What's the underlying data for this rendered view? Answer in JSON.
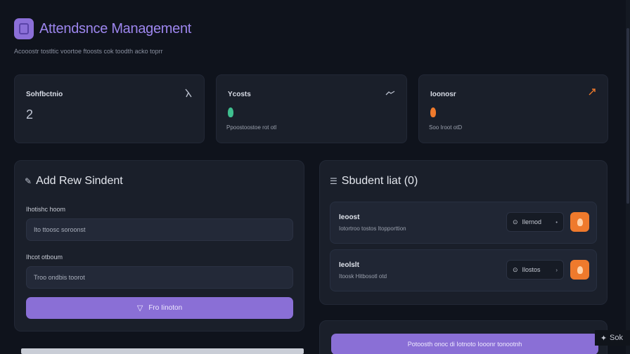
{
  "header": {
    "title": "Attendsnce Management",
    "subtitle": "Acooostr tostltic voortoe ftoosts  cok  toodth acko toprr"
  },
  "stats": [
    {
      "label": "Sohfbctnio",
      "value": "2",
      "icon": "user-icon",
      "color": "#b9bfcc"
    },
    {
      "label": "Ycosts",
      "note": "Ppoostoostoe rot otl",
      "icon": "check-icon",
      "color": "#3fbf8f"
    },
    {
      "label": "Ioonosr",
      "note": "Soo Iroot otD",
      "icon": "alert-icon",
      "color": "#ef7a2c"
    }
  ],
  "add_student": {
    "title": "Add Rew Sindent",
    "name_label": "Ihotishc hoom",
    "name_placeholder": "Ito ttoosc soroonst",
    "id_label": "Ihcot otboum",
    "id_placeholder": "Troo ondbis toorot",
    "submit_label": "Fro Iinoton"
  },
  "student_list": {
    "title": "Sbudent liat (0)",
    "rows": [
      {
        "name": "Ieoost",
        "meta": "Iotortroo tostos Itopporttion",
        "status": "Ilernod"
      },
      {
        "name": "Ieolslt",
        "meta": "Itoosk Hitbosotl otd",
        "status": "Ilostos"
      }
    ]
  },
  "bottom_button_label": "Potoosth onoc di Iotnoto Iooonr  tonootnh",
  "badge_text": "Sok",
  "colors": {
    "accent": "#8a6fd6",
    "success": "#3fbf8f",
    "danger": "#ef7a2c",
    "title": "#9d86ee"
  }
}
